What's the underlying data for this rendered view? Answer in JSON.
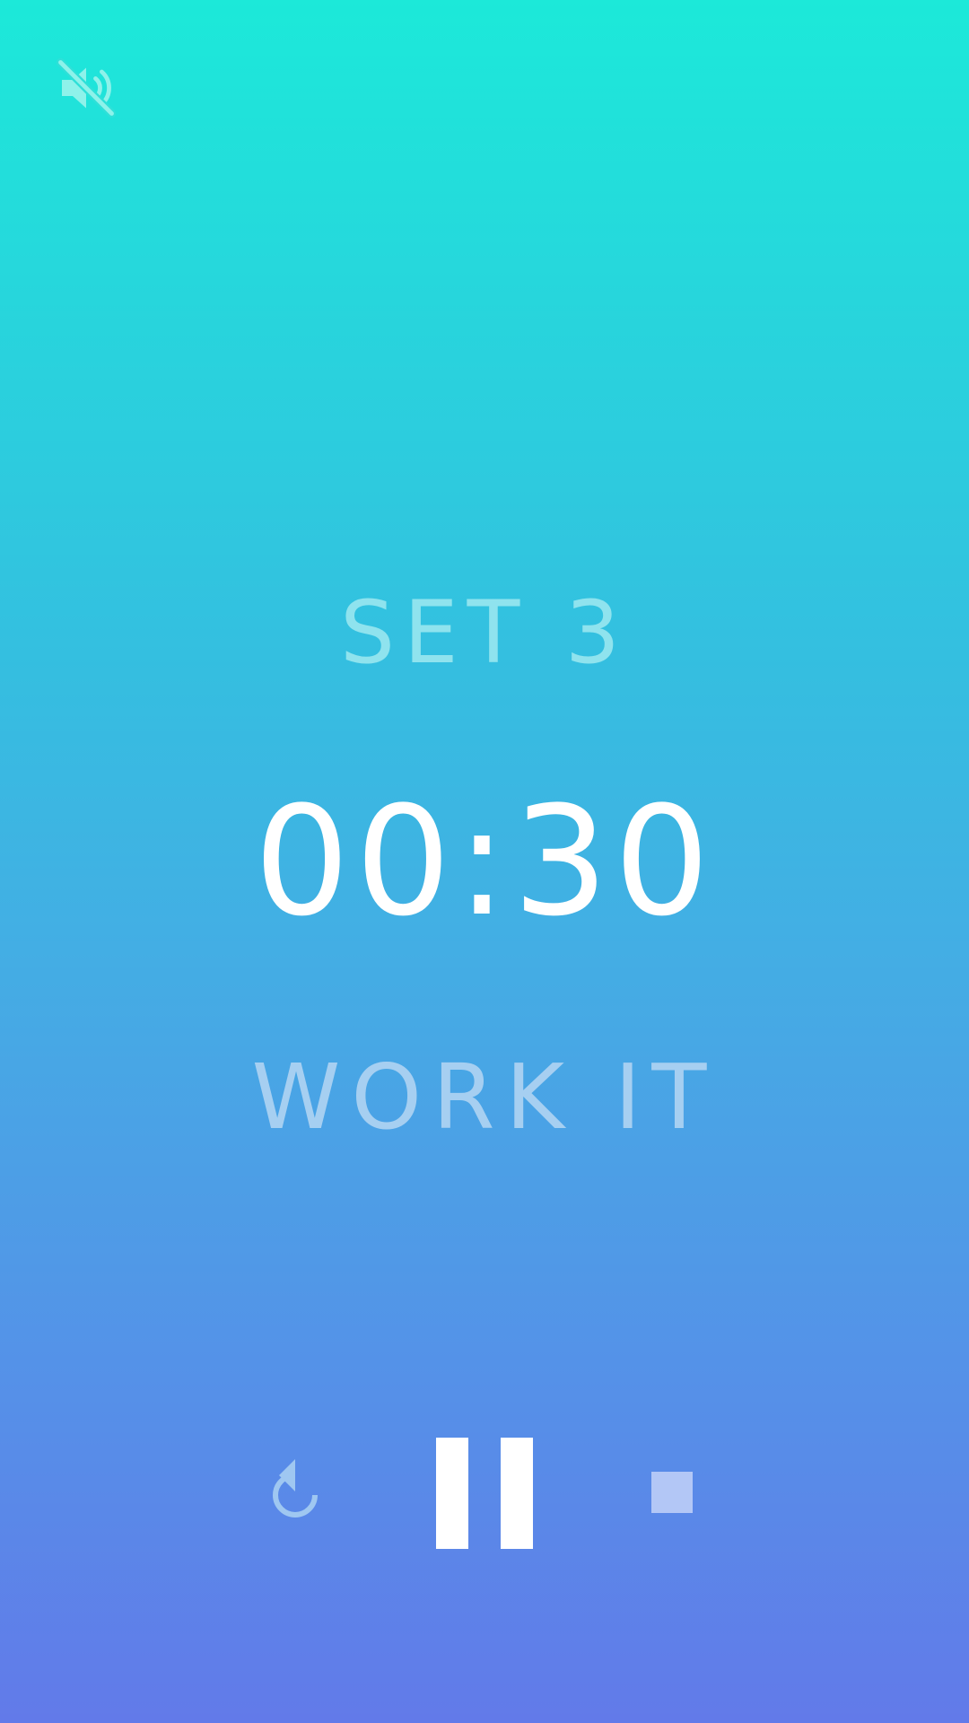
{
  "timer_screen": {
    "set_label": "SET 3",
    "time_remaining": "00:30",
    "phase_label": "WORK IT"
  },
  "icons": {
    "mute": "volume-off-icon",
    "restart": "replay-icon",
    "pause": "pause-icon",
    "stop": "stop-icon"
  },
  "colors": {
    "gradient_top": "#1ce9d9",
    "gradient_bottom": "#627ae9",
    "set_label": "#8fe3ee",
    "timer": "#ffffff",
    "phase_label": "#a6cff1",
    "stop_icon": "#b3c7f6"
  }
}
